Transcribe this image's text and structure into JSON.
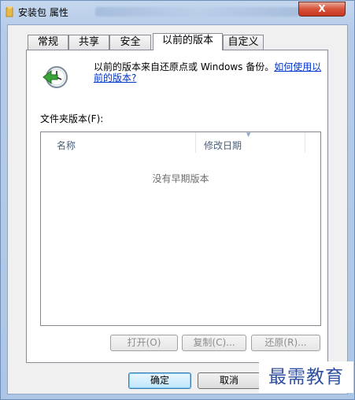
{
  "window": {
    "title": "安装包 属性",
    "close_symbol": "X"
  },
  "tabs": [
    {
      "label": "常规"
    },
    {
      "label": "共享"
    },
    {
      "label": "安全"
    },
    {
      "label": "以前的版本",
      "active": true
    },
    {
      "label": "自定义"
    }
  ],
  "info": {
    "text": "以前的版本来自还原点或 Windows 备份。",
    "link": "如何使用以前的版本?",
    "icon": "clock-restore-icon"
  },
  "folder_versions": {
    "label": "文件夹版本(F):",
    "columns": [
      "名称",
      "修改日期"
    ],
    "empty_text": "没有早期版本"
  },
  "action_buttons": {
    "open": "打开(O)",
    "copy": "复制(C)...",
    "restore": "还原(R)..."
  },
  "dialog_buttons": {
    "ok": "确定",
    "cancel": "取消"
  },
  "watermark": "最需教育"
}
